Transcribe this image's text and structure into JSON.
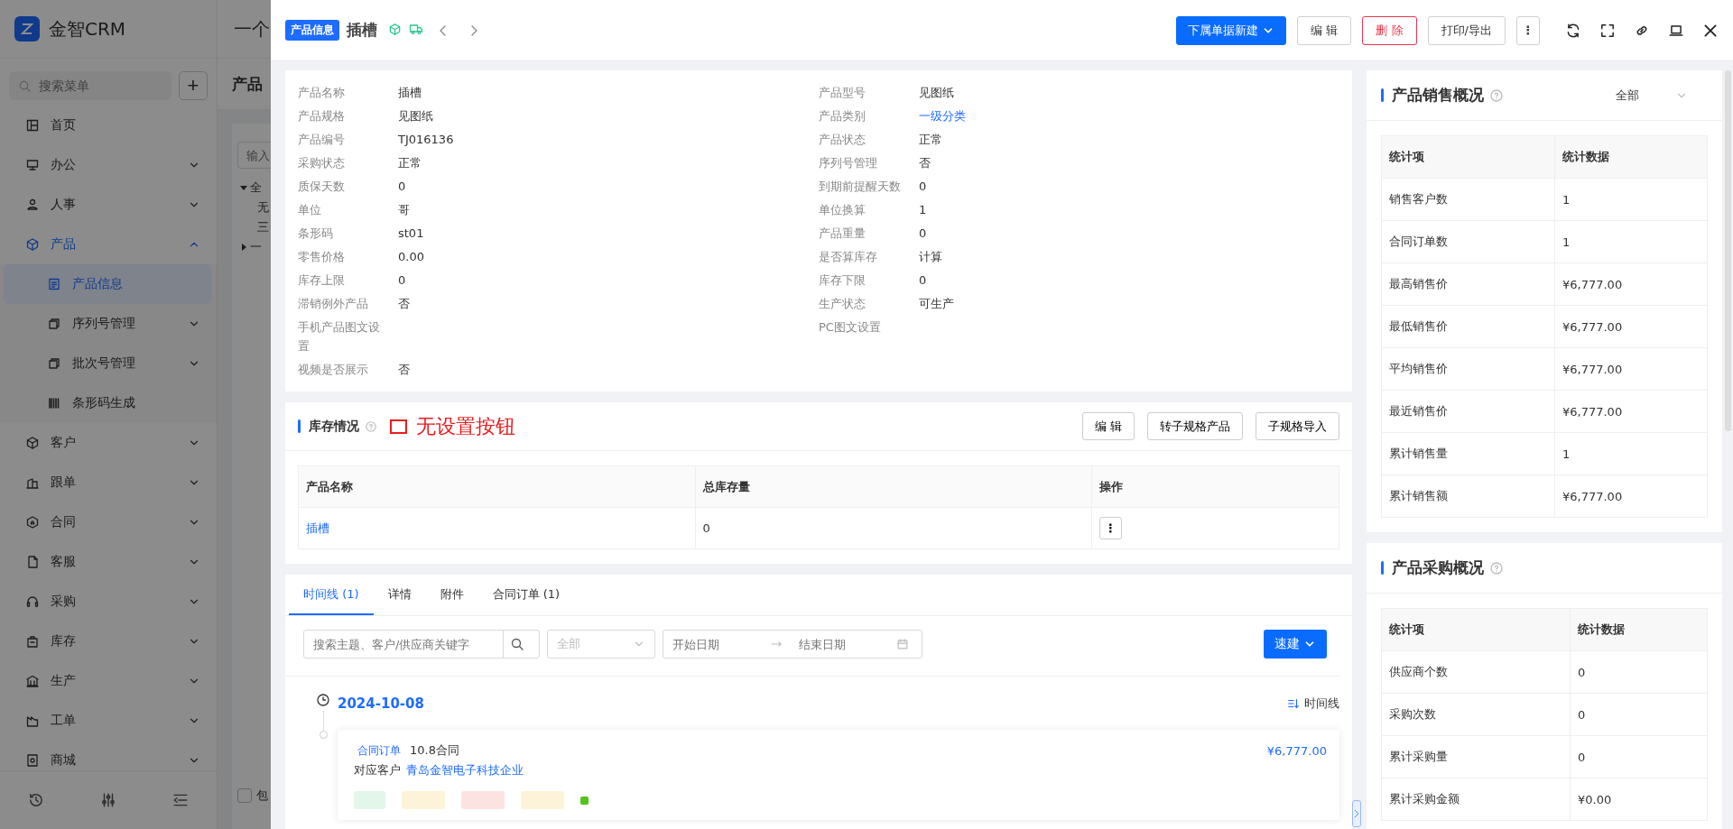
{
  "background": {
    "app_name": "金智CRM",
    "header_title": "一个",
    "search": {
      "placeholder": "搜索菜单"
    },
    "add_button": "+",
    "menu": [
      {
        "label": "首页",
        "kind": "link",
        "selected": false
      },
      {
        "label": "办公",
        "kind": "group",
        "selected": false,
        "expanded": false
      },
      {
        "label": "人事",
        "kind": "group",
        "selected": false,
        "expanded": false
      },
      {
        "label": "产品",
        "kind": "group",
        "selected": true,
        "expanded": true,
        "children": [
          {
            "label": "产品信息",
            "kind": "link",
            "selected": true
          },
          {
            "label": "序列号管理",
            "kind": "group",
            "selected": false,
            "expanded": false
          },
          {
            "label": "批次号管理",
            "kind": "group",
            "selected": false,
            "expanded": false
          },
          {
            "label": "条形码生成",
            "kind": "link",
            "selected": false
          }
        ]
      },
      {
        "label": "客户",
        "kind": "group",
        "selected": false,
        "expanded": false
      },
      {
        "label": "跟单",
        "kind": "group",
        "selected": false,
        "expanded": false
      },
      {
        "label": "合同",
        "kind": "group",
        "selected": false,
        "expanded": false
      },
      {
        "label": "客服",
        "kind": "group",
        "selected": false,
        "expanded": false
      },
      {
        "label": "采购",
        "kind": "group",
        "selected": false,
        "expanded": false
      },
      {
        "label": "库存",
        "kind": "group",
        "selected": false,
        "expanded": false
      },
      {
        "label": "生产",
        "kind": "group",
        "selected": false,
        "expanded": false
      },
      {
        "label": "工单",
        "kind": "group",
        "selected": false,
        "expanded": false
      },
      {
        "label": "商城",
        "kind": "group",
        "selected": false,
        "expanded": false
      }
    ],
    "page_title": "产品",
    "filter": {
      "placeholder": "输入"
    },
    "tree": [
      {
        "label": "全",
        "expanded": true
      },
      {
        "label": "无"
      },
      {
        "label": "三"
      },
      {
        "label": "一",
        "expanded": false
      }
    ],
    "checkbox": {
      "label": "包",
      "checked": false
    }
  },
  "drawer": {
    "badge": "产品信息",
    "title": "插槽",
    "actions": [
      {
        "label": "下属单据新建",
        "kind": "primary"
      },
      {
        "label": "编 辑",
        "kind": "default"
      },
      {
        "label": "删 除",
        "kind": "danger"
      },
      {
        "label": "打印/导出",
        "kind": "default"
      },
      {
        "label": "⋮",
        "kind": "default"
      }
    ],
    "details": {
      "left": [
        {
          "label": "产品名称",
          "value": "插槽"
        },
        {
          "label": "产品规格",
          "value": "见图纸"
        },
        {
          "label": "产品编号",
          "value": "TJ016136"
        },
        {
          "label": "采购状态",
          "value": "正常"
        },
        {
          "label": "质保天数",
          "value": "0"
        },
        {
          "label": "单位",
          "value": "哥"
        },
        {
          "label": "条形码",
          "value": "st01"
        },
        {
          "label": "零售价格",
          "value": "0.00"
        },
        {
          "label": "库存上限",
          "value": "0"
        },
        {
          "label": "滞销例外产品",
          "value": "否"
        },
        {
          "label": "手机产品图文设置"
        },
        {
          "label": "视频是否展示",
          "value": "否"
        }
      ],
      "right": [
        {
          "label": "产品型号",
          "value": "见图纸"
        },
        {
          "label": "产品类别",
          "value": "一级分类",
          "kind": "link"
        },
        {
          "label": "产品状态",
          "value": "正常"
        },
        {
          "label": "序列号管理",
          "value": "否"
        },
        {
          "label": "到期前提醒天数",
          "value": "0"
        },
        {
          "label": "单位换算",
          "value": "1"
        },
        {
          "label": "产品重量",
          "value": "0"
        },
        {
          "label": "是否算库存",
          "value": "计算"
        },
        {
          "label": "库存下限",
          "value": "0"
        },
        {
          "label": "生产状态",
          "value": "可生产"
        },
        {
          "label": "PC图文设置"
        }
      ]
    },
    "stock": {
      "title": "库存情况",
      "annotation": "无设置按钮",
      "buttons": [
        "编 辑",
        "转子规格产品",
        "子规格导入"
      ],
      "columns": [
        "产品名称",
        "总库存量",
        "操作"
      ],
      "rows": [
        {
          "name": "插槽",
          "total": "0",
          "action": "⋮"
        }
      ]
    },
    "timeline": {
      "tabs": [
        {
          "label": "时间线 (1)",
          "selected": true
        },
        {
          "label": "详情",
          "selected": false
        },
        {
          "label": "附件",
          "selected": false
        },
        {
          "label": "合同订单 (1)",
          "selected": false
        }
      ],
      "search": {
        "placeholder": "搜索主题、客户/供应商关键字"
      },
      "type_select": "全部",
      "start_date": {
        "placeholder": "开始日期"
      },
      "end_date": {
        "placeholder": "结束日期"
      },
      "quick_create": "速建",
      "date": "2024-10-08",
      "view_toggle": "时间线",
      "entry": {
        "tag": "合同订单",
        "title": "10.8合同",
        "amount": "¥6,777.00",
        "customer_label": "对应客户",
        "customer": "青岛金智电子科技企业",
        "chips": [
          {
            "color": "#e3f6ea"
          },
          {
            "color": "#fdf3d8"
          },
          {
            "color": "#fde2e2"
          },
          {
            "color": "#fdf3d8"
          },
          {
            "color": "#52c41a"
          }
        ]
      }
    },
    "sales": {
      "title": "产品销售概况",
      "range": "全部",
      "columns": [
        "统计项",
        "统计数据"
      ],
      "rows": [
        [
          "销售客户数",
          "1"
        ],
        [
          "合同订单数",
          "1"
        ],
        [
          "最高销售价",
          "¥6,777.00"
        ],
        [
          "最低销售价",
          "¥6,777.00"
        ],
        [
          "平均销售价",
          "¥6,777.00"
        ],
        [
          "最近销售价",
          "¥6,777.00"
        ],
        [
          "累计销售量",
          "1"
        ],
        [
          "累计销售额",
          "¥6,777.00"
        ]
      ]
    },
    "purchase": {
      "title": "产品采购概况",
      "columns": [
        "统计项",
        "统计数据"
      ],
      "rows": [
        [
          "供应商个数",
          "0"
        ],
        [
          "采购次数",
          "0"
        ],
        [
          "累计采购量",
          "0"
        ],
        [
          "累计采购金额",
          "¥0.00"
        ]
      ]
    }
  }
}
